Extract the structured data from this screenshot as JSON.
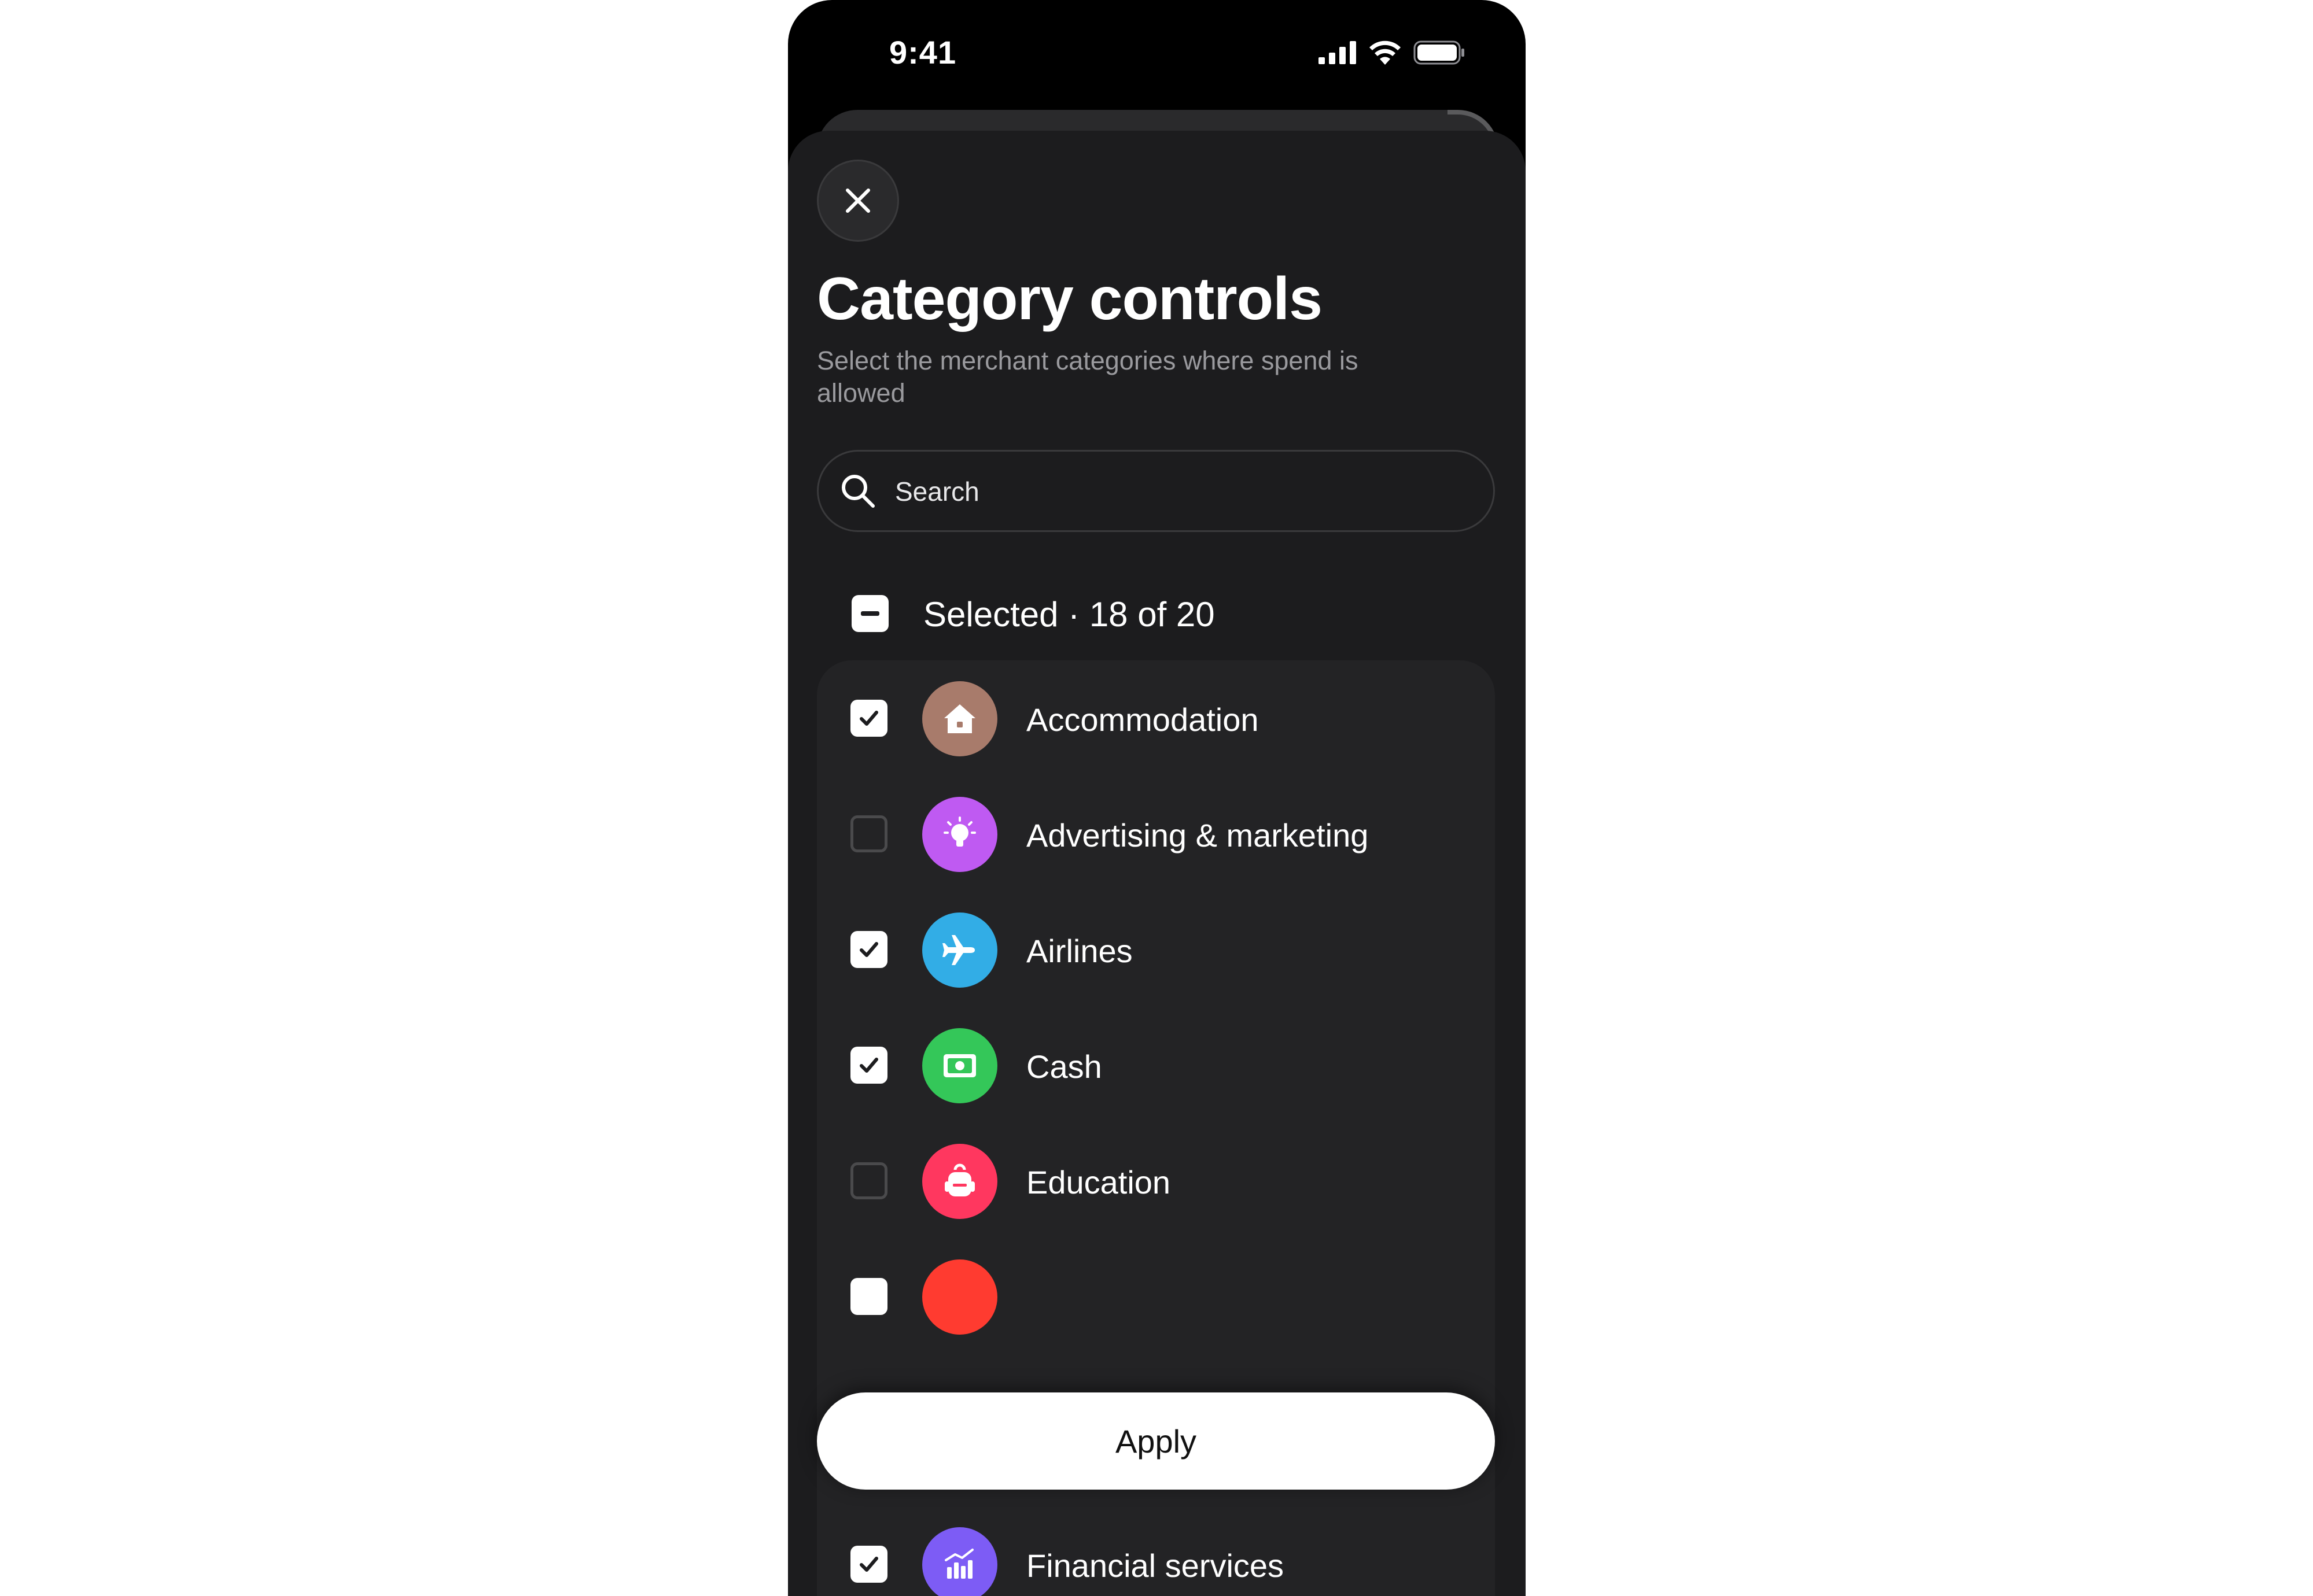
{
  "status_bar": {
    "time": "9:41"
  },
  "header": {
    "title": "Category controls",
    "subtitle": "Select the merchant categories where spend is allowed"
  },
  "search": {
    "placeholder": "Search"
  },
  "selection": {
    "label": "Selected · 18 of 20",
    "state": "indeterminate"
  },
  "categories": [
    {
      "label": "Accommodation",
      "checked": true,
      "icon": "house-icon",
      "color": "#A87B6B"
    },
    {
      "label": "Advertising & marketing",
      "checked": false,
      "icon": "lightbulb-icon",
      "color": "#BF5AF2"
    },
    {
      "label": "Airlines",
      "checked": true,
      "icon": "airplane-icon",
      "color": "#32ADE6"
    },
    {
      "label": "Cash",
      "checked": true,
      "icon": "banknote-icon",
      "color": "#34C759"
    },
    {
      "label": "Education",
      "checked": false,
      "icon": "backpack-icon",
      "color": "#FF375F"
    },
    {
      "label": "",
      "checked": true,
      "icon": "category-icon",
      "color": "#FF3B30"
    },
    {
      "label": "Financial services",
      "checked": true,
      "icon": "chart-icon",
      "color": "#7D5CF5"
    }
  ],
  "footer": {
    "apply_label": "Apply"
  },
  "colors": {
    "sheet_background": "#1C1C1E",
    "list_background": "#232325",
    "primary_button": "#FFFFFF"
  }
}
